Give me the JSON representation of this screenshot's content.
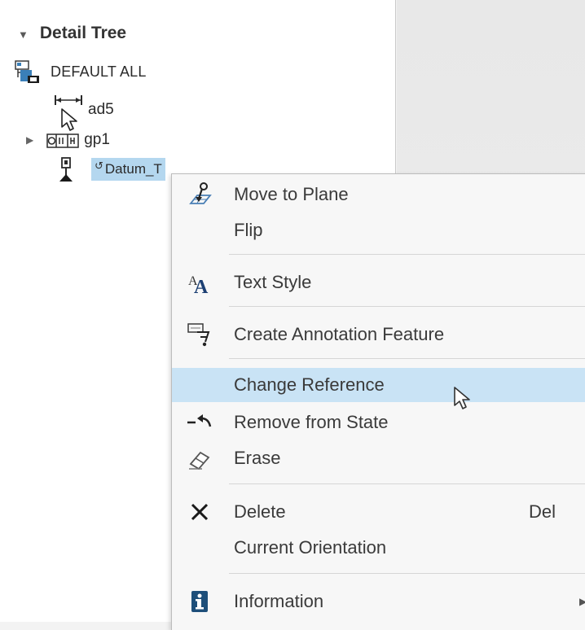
{
  "detail_tree": {
    "header": "Detail Tree",
    "collapse_icon": "triangle-down-icon",
    "nodes": [
      {
        "label": "DEFAULT ALL",
        "icon": "state-tree-icon"
      },
      {
        "label": "ad5",
        "icon": "dimension-icon"
      },
      {
        "label": "gp1",
        "icon": "gtol-icon"
      },
      {
        "label": "Datum_Tag A",
        "shown_text": "Datum_T",
        "icon": "datum-tag-icon",
        "selected": true
      }
    ]
  },
  "context_menu": {
    "items": [
      {
        "label": "Move to Plane",
        "icon": "move-to-plane-icon"
      },
      {
        "label": "Flip",
        "icon": ""
      },
      {
        "label": "Text Style",
        "icon": "text-style-icon"
      },
      {
        "label": "Create Annotation Feature",
        "icon": "annotation-feature-icon"
      },
      {
        "label": "Change Reference",
        "icon": "",
        "highlighted": true
      },
      {
        "label": "Remove from State",
        "icon": "remove-from-state-icon"
      },
      {
        "label": "Erase",
        "icon": "eraser-icon"
      },
      {
        "label": "Delete",
        "icon": "delete-x-icon",
        "shortcut": "Del"
      },
      {
        "label": "Current Orientation",
        "icon": ""
      },
      {
        "label": "Information",
        "icon": "information-icon",
        "submenu": true
      }
    ]
  },
  "colors": {
    "selection": "#b4d7ef",
    "menu_highlight": "#c9e3f5",
    "menu_background": "#f7f7f7",
    "info_icon": "#1e4f7a"
  }
}
